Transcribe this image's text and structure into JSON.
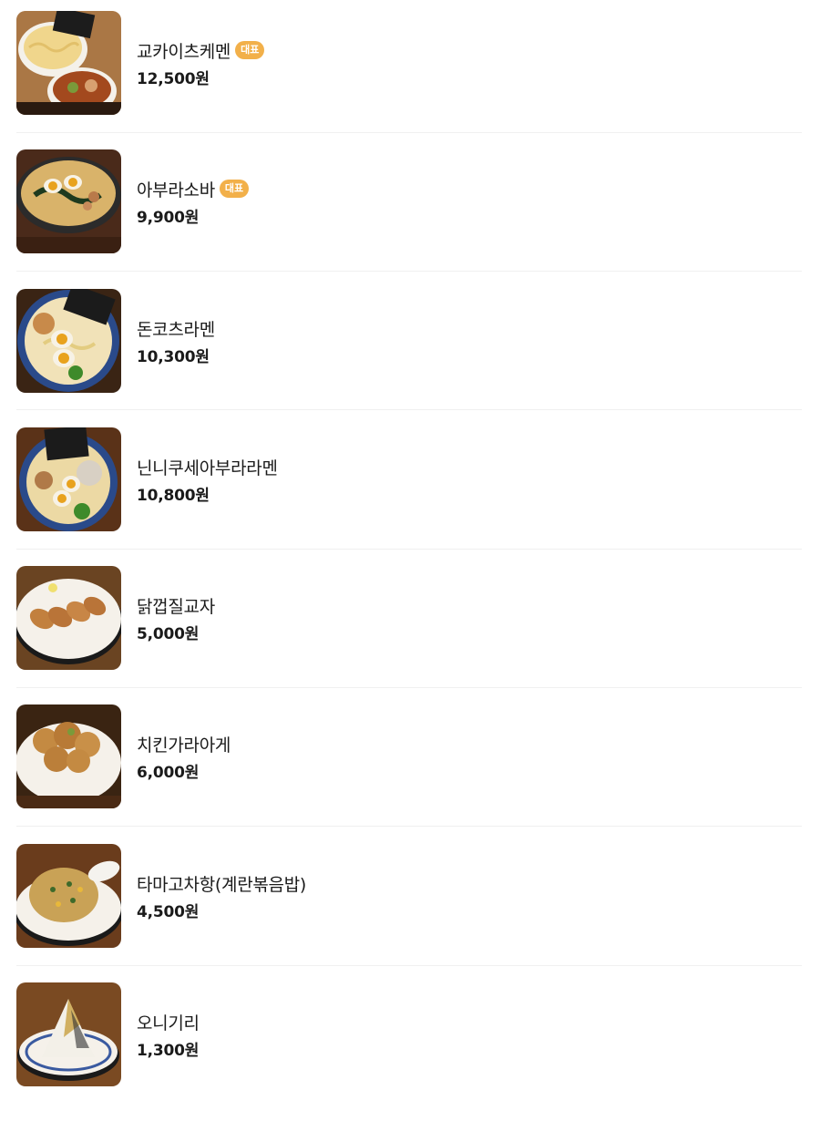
{
  "menu": {
    "items": [
      {
        "name": "교카이츠케멘",
        "badge": "대표",
        "price": "12,500원",
        "image": "tsukemen-dish-photo"
      },
      {
        "name": "아부라소바",
        "badge": "대표",
        "price": "9,900원",
        "image": "abura-soba-dish-photo"
      },
      {
        "name": "돈코츠라멘",
        "badge": "",
        "price": "10,300원",
        "image": "tonkotsu-ramen-dish-photo"
      },
      {
        "name": "닌니쿠세아부라라멘",
        "badge": "",
        "price": "10,800원",
        "image": "garlic-ramen-dish-photo"
      },
      {
        "name": "닭껍질교자",
        "badge": "",
        "price": "5,000원",
        "image": "chicken-skin-gyoza-dish-photo"
      },
      {
        "name": "치킨가라아게",
        "badge": "",
        "price": "6,000원",
        "image": "chicken-karaage-dish-photo"
      },
      {
        "name": "타마고차항(계란볶음밥)",
        "badge": "",
        "price": "4,500원",
        "image": "egg-fried-rice-dish-photo"
      },
      {
        "name": "오니기리",
        "badge": "",
        "price": "1,300원",
        "image": "onigiri-dish-photo"
      }
    ]
  },
  "colors": {
    "badge_bg": "#f2b04a",
    "divider": "#f0f0f0",
    "text": "#1a1a1a"
  }
}
